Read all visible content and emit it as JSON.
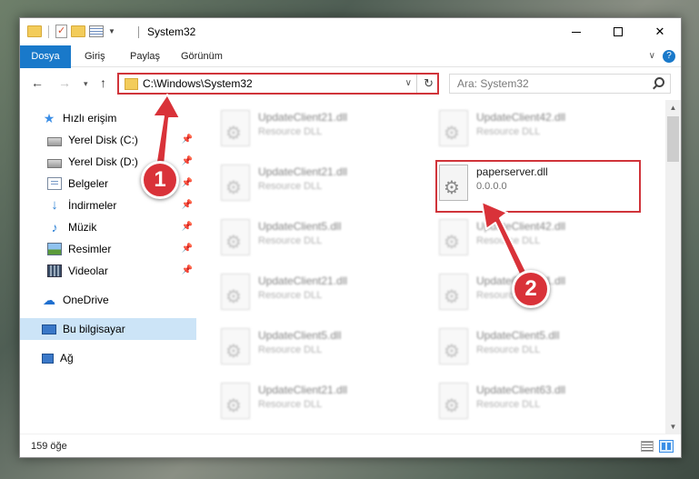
{
  "window": {
    "title": "System32",
    "controls": {
      "minimize": "minimize",
      "maximize": "maximize",
      "close": "✕"
    }
  },
  "ribbon": {
    "tabs": [
      "Dosya",
      "Giriş",
      "Paylaş",
      "Görünüm"
    ],
    "expand_icon": "chevron-down-icon",
    "help_label": "?"
  },
  "nav": {
    "back": "←",
    "forward": "→",
    "recent": "▾",
    "up": "↑",
    "address": "C:\\Windows\\System32",
    "search_placeholder": "Ara: System32"
  },
  "sidebar": {
    "items": [
      {
        "label": "Hızlı erişim",
        "icon": "star-icon"
      },
      {
        "label": "Yerel Disk (C:)",
        "icon": "disk-icon",
        "pinned": true
      },
      {
        "label": "Yerel Disk (D:)",
        "icon": "disk-icon",
        "pinned": true
      },
      {
        "label": "Belgeler",
        "icon": "documents-icon",
        "pinned": true
      },
      {
        "label": "İndirmeler",
        "icon": "download-icon",
        "pinned": true
      },
      {
        "label": "Müzik",
        "icon": "music-icon",
        "pinned": true
      },
      {
        "label": "Resimler",
        "icon": "pictures-icon",
        "pinned": true
      },
      {
        "label": "Videolar",
        "icon": "videos-icon",
        "pinned": true
      },
      {
        "label": "OneDrive",
        "icon": "cloud-icon"
      },
      {
        "label": "Bu bilgisayar",
        "icon": "computer-icon",
        "selected": true
      },
      {
        "label": "Ağ",
        "icon": "network-icon"
      }
    ]
  },
  "files": [
    {
      "name": "UpdateClient21.dll",
      "desc": "Resource DLL"
    },
    {
      "name": "UpdateClient42.dll",
      "desc": "Resource DLL"
    },
    {
      "name": "UpdateClient21.dll",
      "desc": "Resource DLL"
    },
    {
      "name": "paperserver.dll",
      "desc": "0.0.0.0",
      "highlighted": true
    },
    {
      "name": "UpdateClient5.dll",
      "desc": "Resource DLL"
    },
    {
      "name": "UpdateClient42.dll",
      "desc": "Resource DLL"
    },
    {
      "name": "UpdateClient21.dll",
      "desc": "Resource DLL"
    },
    {
      "name": "UpdateClient21.dll",
      "desc": "Resource DLL"
    },
    {
      "name": "UpdateClient5.dll",
      "desc": "Resource DLL"
    },
    {
      "name": "UpdateClient5.dll",
      "desc": "Resource DLL"
    },
    {
      "name": "UpdateClient21.dll",
      "desc": "Resource DLL"
    },
    {
      "name": "UpdateClient63.dll",
      "desc": "Resource DLL"
    }
  ],
  "status": {
    "count": "159 öğe"
  },
  "annotations": {
    "step1": "1",
    "step2": "2",
    "color": "#d93239"
  }
}
